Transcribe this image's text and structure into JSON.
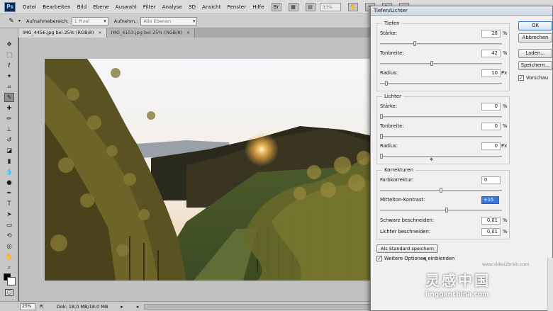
{
  "menu": {
    "items": [
      "Datei",
      "Bearbeiten",
      "Bild",
      "Ebene",
      "Auswahl",
      "Filter",
      "Analyse",
      "3D",
      "Ansicht",
      "Fenster",
      "Hilfe"
    ],
    "zoom_value": "33%",
    "logo": "Ps"
  },
  "options_bar": {
    "sample_area_label": "Aufnahmebereich:",
    "sample_area_value": "1 Pixel",
    "sample_label": "Aufnehm.:",
    "sample_value": "Alle Ebenen"
  },
  "tabs": [
    {
      "label": "IMG_4456.jpg bei 25% (RGB/8)",
      "active": true
    },
    {
      "label": "IMG_4153.jpg bei 25% (RGB/8)",
      "active": false
    }
  ],
  "status": {
    "zoom": "25%",
    "doc_info": "Dok: 18,0 MB/18,0 MB"
  },
  "dialog": {
    "title": "Tiefen/Lichter",
    "buttons": {
      "ok": "OK",
      "cancel": "Abbrechen",
      "load": "Laden...",
      "save": "Speichern..."
    },
    "preview_label": "Vorschau",
    "preview_checked": true,
    "shadows": {
      "title": "Tiefen",
      "amount_label": "Stärke:",
      "amount": "28",
      "amount_unit": "%",
      "tonal_label": "Tonbreite:",
      "tonal": "42",
      "tonal_unit": "%",
      "radius_label": "Radius:",
      "radius": "10",
      "radius_unit": "Px"
    },
    "highlights": {
      "title": "Lichter",
      "amount_label": "Stärke:",
      "amount": "0",
      "amount_unit": "%",
      "tonal_label": "Tonbreite:",
      "tonal": "0",
      "tonal_unit": "%",
      "radius_label": "Radius:",
      "radius": "0",
      "radius_unit": "Px"
    },
    "corrections": {
      "title": "Korrekturen",
      "color_label": "Farbkorrektur:",
      "color": "0",
      "midtone_label": "Mittelton-Kontrast:",
      "midtone": "+15",
      "black_clip_label": "Schwarz beschneiden:",
      "black_clip": "0,01",
      "black_clip_unit": "%",
      "white_clip_label": "Lichter beschneiden:",
      "white_clip": "0,01",
      "white_clip_unit": "%"
    },
    "save_defaults_label": "Als Standard speichern",
    "more_options_label": "Weitere Optionen einblenden",
    "more_options_checked": true
  },
  "sliders": {
    "shadow_amount": 0.28,
    "shadow_tonal": 0.42,
    "shadow_radius": 0.04,
    "highlight_amount": 0,
    "highlight_tonal": 0,
    "highlight_radius": 0,
    "color_correction": 0.5,
    "midtone_contrast": 0.55
  },
  "watermark": {
    "top": "灵感中国",
    "sub": "lingganchina.com",
    "url": "www.video2brain.com"
  }
}
